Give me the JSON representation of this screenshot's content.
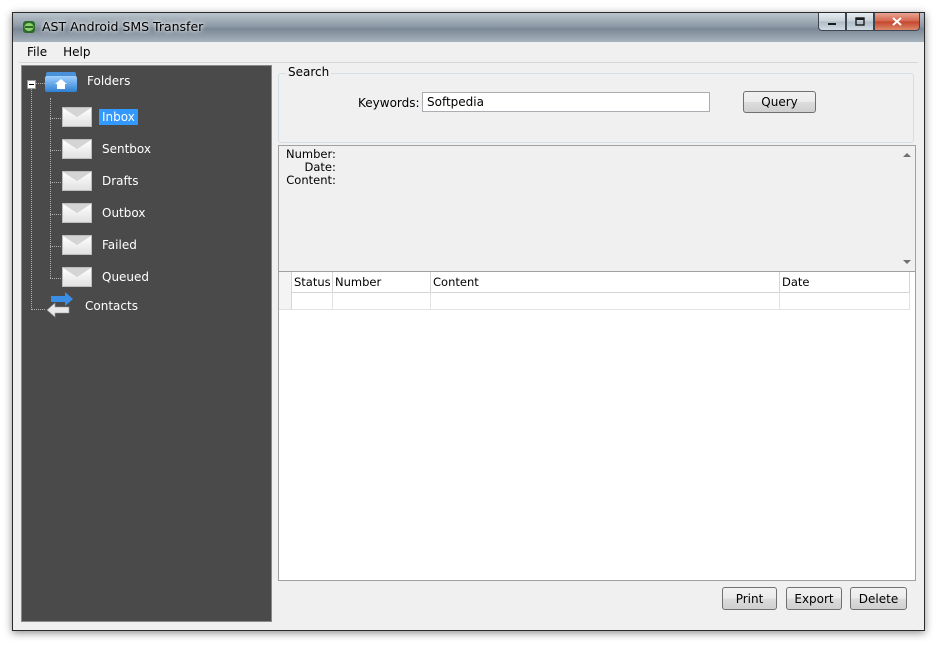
{
  "window": {
    "title": "AST Android SMS Transfer"
  },
  "menu": {
    "items": [
      "File",
      "Help"
    ]
  },
  "tree": {
    "root_label": "Folders",
    "folders": [
      "Inbox",
      "Sentbox",
      "Drafts",
      "Outbox",
      "Failed",
      "Queued"
    ],
    "selected": "Inbox",
    "contacts_label": "Contacts"
  },
  "search": {
    "group_label": "Search",
    "keywords_label": "Keywords:",
    "keywords_value": "Softpedia",
    "query_label": "Query"
  },
  "details": {
    "number_label": "Number:",
    "date_label": "Date:",
    "content_label": "Content:"
  },
  "table": {
    "columns": [
      "Status",
      "Number",
      "Content",
      "Date"
    ]
  },
  "actions": {
    "print": "Print",
    "export": "Export",
    "delete": "Delete"
  },
  "colors": {
    "sidebar_bg": "#4a4a4a",
    "selection": "#3399ff",
    "window_bg": "#f0f0f0"
  }
}
